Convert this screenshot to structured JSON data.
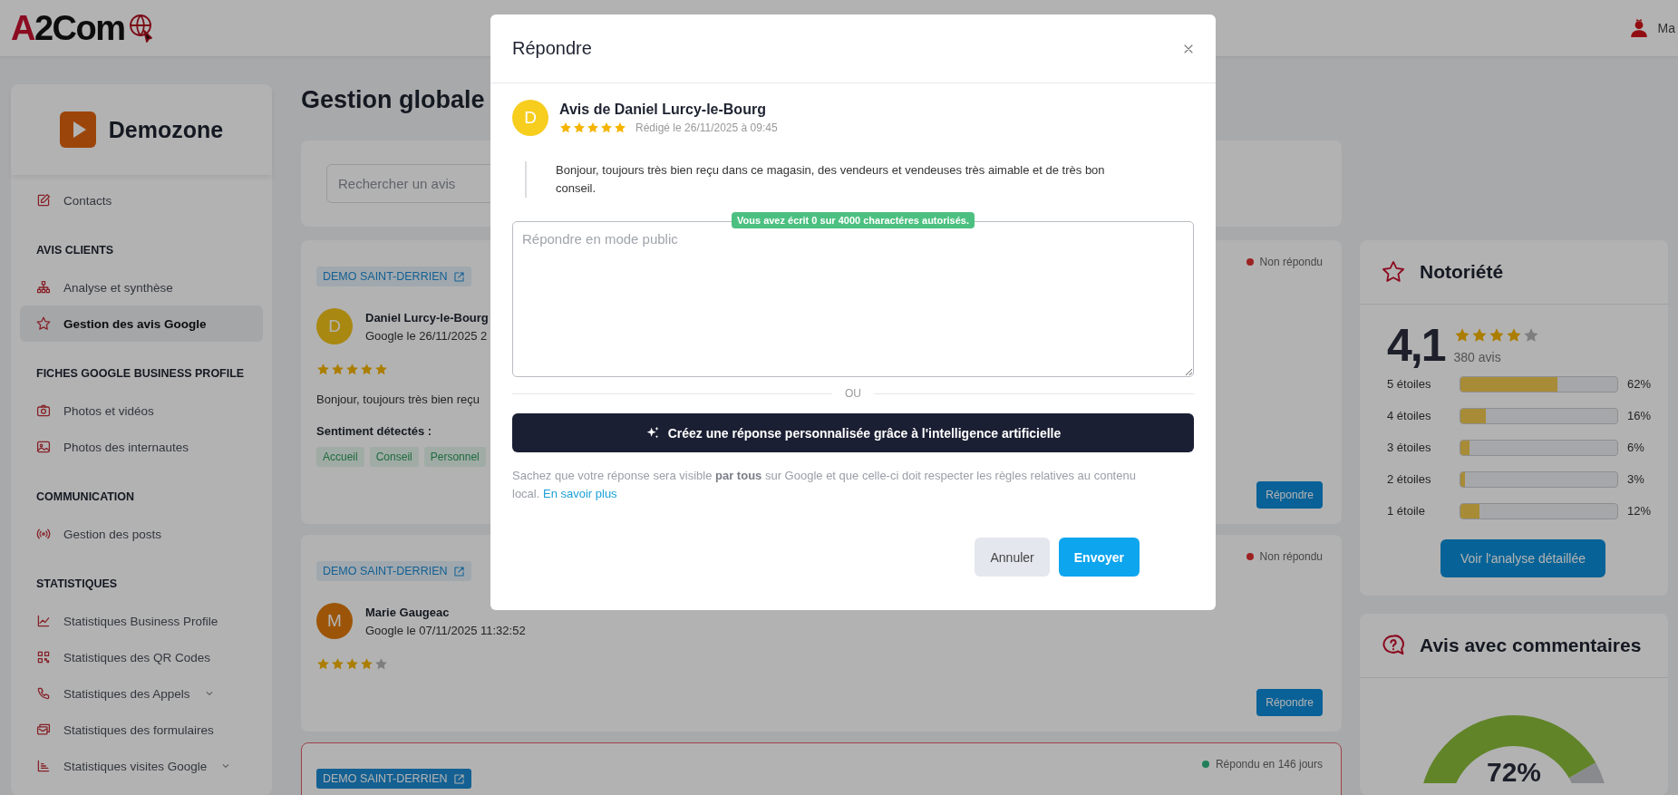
{
  "header": {
    "logo": "A2Com",
    "user_name": "Ma"
  },
  "sidebar": {
    "brand": "Demozone",
    "sections": [
      {
        "items": [
          {
            "label": "Contacts",
            "selected": false,
            "expandable": false
          }
        ]
      },
      {
        "title": "AVIS CLIENTS",
        "items": [
          {
            "label": "Analyse et synthèse",
            "selected": false,
            "expandable": false
          },
          {
            "label": "Gestion des avis Google",
            "selected": true,
            "expandable": false
          }
        ]
      },
      {
        "title": "FICHES GOOGLE BUSINESS PROFILE",
        "items": [
          {
            "label": "Photos et vidéos",
            "selected": false,
            "expandable": false
          },
          {
            "label": "Photos des internautes",
            "selected": false,
            "expandable": false
          }
        ]
      },
      {
        "title": "COMMUNICATION",
        "items": [
          {
            "label": "Gestion des posts",
            "selected": false,
            "expandable": false
          }
        ]
      },
      {
        "title": "STATISTIQUES",
        "items": [
          {
            "label": "Statistiques Business Profile",
            "selected": false,
            "expandable": false
          },
          {
            "label": "Statistiques des QR Codes",
            "selected": false,
            "expandable": false
          },
          {
            "label": "Statistiques des Appels",
            "selected": false,
            "expandable": true
          },
          {
            "label": "Statistiques des formulaires",
            "selected": false,
            "expandable": false
          },
          {
            "label": "Statistiques visites Google",
            "selected": false,
            "expandable": true
          }
        ]
      }
    ]
  },
  "main": {
    "title": "Gestion globale",
    "search": {
      "placeholder": "Rechercher un avis"
    },
    "reviews": [
      {
        "site": "DEMO SAINT-DERRIEN",
        "status": "Non répondu",
        "color": "#9d2222",
        "highlighted": false,
        "initial": "D",
        "author": "Daniel Lurcy-le-Bourg",
        "date": "Google le 26/11/2025 2",
        "stars": 5,
        "text": "Bonjour, toujours très bien reçu",
        "sentiment_label": "Sentiment détectés :",
        "tags": [
          "Accueil",
          "Conseil",
          "Personnel"
        ],
        "reply": "Répondre"
      },
      {
        "site": "DEMO SAINT-DERRIEN",
        "status": "Non répondu",
        "color": "#9d2222",
        "highlighted": false,
        "initial": "M",
        "author": "Marie Gaugeac",
        "date": "Google le 07/11/2025 11:32:52",
        "stars": 4,
        "reply": "Répondre"
      },
      {
        "site": "DEMO SAINT-DERRIEN",
        "status": "Répondu en 146 jours",
        "color": "#21805a",
        "highlighted": true
      }
    ]
  },
  "notoriety": {
    "title": "Notoriété",
    "score": "4,1",
    "stars": 4,
    "count": "380 avis",
    "rows": [
      {
        "label": "5 étoiles",
        "level": 0.62,
        "reading": "62%"
      },
      {
        "label": "4 étoiles",
        "level": 0.16,
        "reading": "16%"
      },
      {
        "label": "3 étoiles",
        "level": 0.06,
        "reading": "6%"
      },
      {
        "label": "2 étoiles",
        "level": 0.03,
        "reading": "3%"
      },
      {
        "label": "1 étoile",
        "level": 0.12,
        "reading": "12%"
      }
    ],
    "button": "Voir l'analyse détaillée"
  },
  "comments": {
    "title": "Avis avec commentaires",
    "center_label": "72%",
    "chart_data": {
      "type": "donut",
      "values": [
        72,
        28
      ]
    }
  },
  "modal": {
    "title": "Répondre",
    "review": {
      "initial": "D",
      "title": "Avis de Daniel Lurcy-le-Bourg",
      "stars": 5,
      "date": "Rédigé le 26/11/2025 à 09:45",
      "text": "Bonjour, toujours très bien reçu dans ce magasin, des vendeurs et vendeuses très aimable et de très bon conseil."
    },
    "counter": "Vous avez écrit 0 sur 4000 charactéres autorisés.",
    "reply_field": {
      "placeholder": "Répondre en mode public"
    },
    "separator": "OU",
    "ai_button": "Créez une réponse personnalisée grâce à l'intelligence artificielle",
    "notice": {
      "text": "Sachez que votre réponse sera visible **par tous** sur Google et que celle-ci doit respecter les règles relatives au contenu local.",
      "link": "En savoir plus"
    },
    "buttons": [
      {
        "label": "Annuler",
        "kind": "secondary"
      },
      {
        "label": "Envoyer",
        "kind": "primary"
      }
    ]
  }
}
